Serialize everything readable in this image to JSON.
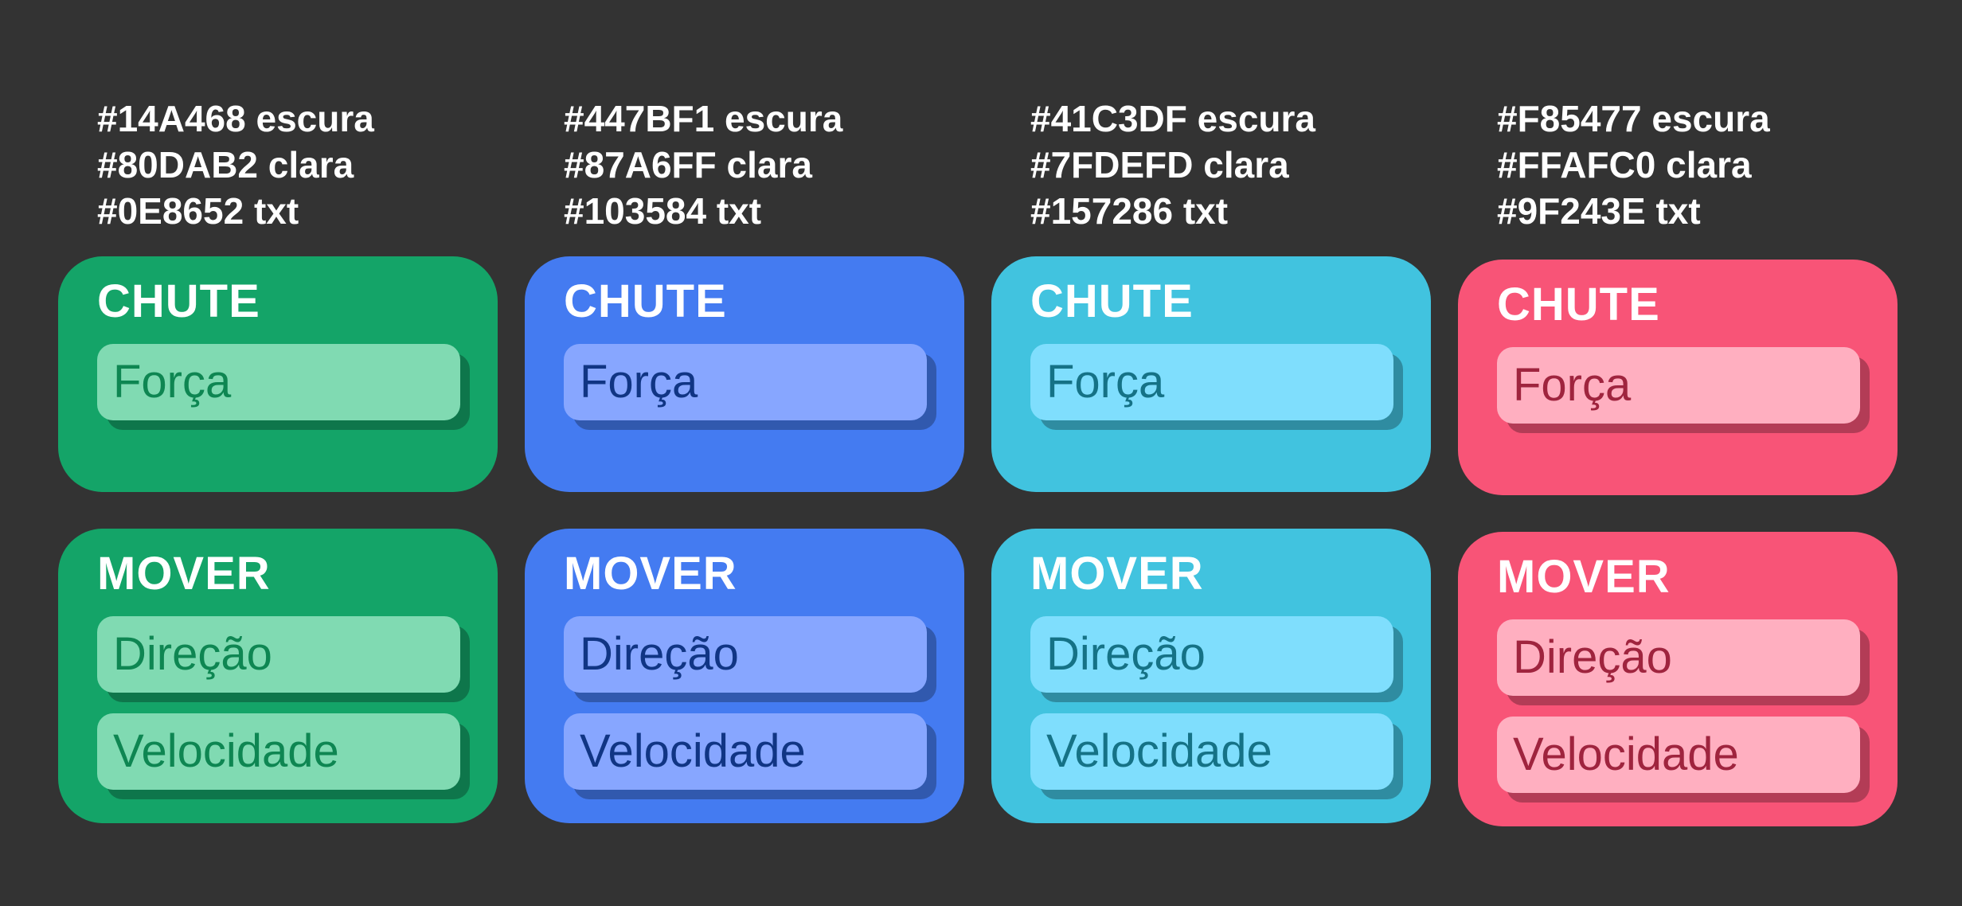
{
  "palettes": [
    {
      "dark_label": "#14A468 escura",
      "light_label": "#80DAB2 clara",
      "text_label": "#0E8652 txt",
      "colors": {
        "dark": "#14A468",
        "light": "#80DAB2",
        "text": "#0E8652"
      },
      "chute": {
        "title": "CHUTE",
        "params": [
          "Força"
        ]
      },
      "mover": {
        "title": "MOVER",
        "params": [
          "Direção",
          "Velocidade"
        ]
      }
    },
    {
      "dark_label": "#447BF1 escura",
      "light_label": "#87A6FF clara",
      "text_label": "#103584 txt",
      "colors": {
        "dark": "#447BF1",
        "light": "#87A6FF",
        "text": "#103584"
      },
      "chute": {
        "title": "CHUTE",
        "params": [
          "Força"
        ]
      },
      "mover": {
        "title": "MOVER",
        "params": [
          "Direção",
          "Velocidade"
        ]
      }
    },
    {
      "dark_label": "#41C3DF escura",
      "light_label": "#7FDEFD clara",
      "text_label": "#157286 txt",
      "colors": {
        "dark": "#41C3DF",
        "light": "#7FDEFD",
        "text": "#157286"
      },
      "chute": {
        "title": "CHUTE",
        "params": [
          "Força"
        ]
      },
      "mover": {
        "title": "MOVER",
        "params": [
          "Direção",
          "Velocidade"
        ]
      }
    },
    {
      "dark_label": "#F85477 escura",
      "light_label": "#FFAFC0 clara",
      "text_label": "#9F243E txt",
      "colors": {
        "dark": "#F85477",
        "light": "#FFAFC0",
        "text": "#9F243E"
      },
      "chute": {
        "title": "CHUTE",
        "params": [
          "Força"
        ]
      },
      "mover": {
        "title": "MOVER",
        "params": [
          "Direção",
          "Velocidade"
        ]
      }
    }
  ]
}
